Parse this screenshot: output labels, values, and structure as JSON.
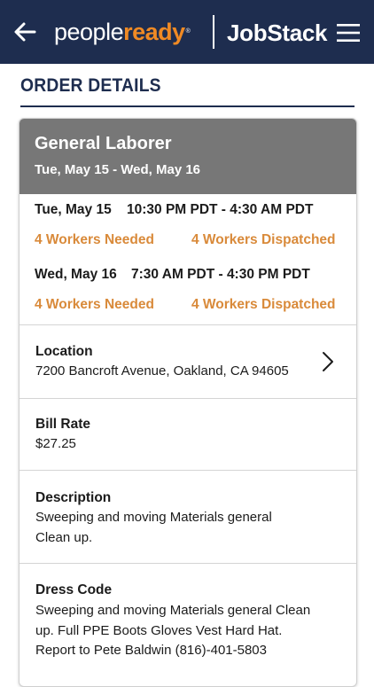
{
  "header": {
    "brand_people": "people",
    "brand_ready": "ready",
    "brand_mark": "®",
    "app_name": "JobStack"
  },
  "page": {
    "title": "ORDER DETAILS"
  },
  "order": {
    "job_title": "General Laborer",
    "date_range": "Tue, May 15 - Wed, May 16",
    "shifts": [
      {
        "date": "Tue, May 15",
        "time": "10:30 PM PDT - 4:30 AM PDT",
        "needed": "4  Workers Needed",
        "dispatched": "4  Workers Dispatched"
      },
      {
        "date": "Wed, May 16",
        "time": "7:30 AM PDT - 4:30 PM PDT",
        "needed": "4  Workers Needed",
        "dispatched": "4  Workers Dispatched"
      }
    ],
    "location": {
      "label": "Location",
      "value": "7200 Bancroft Avenue, Oakland, CA 94605"
    },
    "bill_rate": {
      "label": "Bill Rate",
      "value": "$27.25"
    },
    "description": {
      "label": "Description",
      "value": "Sweeping and moving Materials general Clean up."
    },
    "dress_code": {
      "label": "Dress Code",
      "value": "Sweeping and moving Materials general Clean up. Full PPE Boots Gloves Vest Hard Hat. Report to Pete Baldwin (816)-401-5803"
    }
  },
  "icons": {
    "back": "arrow-left-icon",
    "menu": "hamburger-menu-icon",
    "location_chevron": "chevron-right-icon"
  },
  "colors": {
    "nav_bg": "#1e2d4f",
    "brand_accent": "#f08a24",
    "worker_text": "#d98a3a",
    "card_header_bg": "#777777"
  }
}
